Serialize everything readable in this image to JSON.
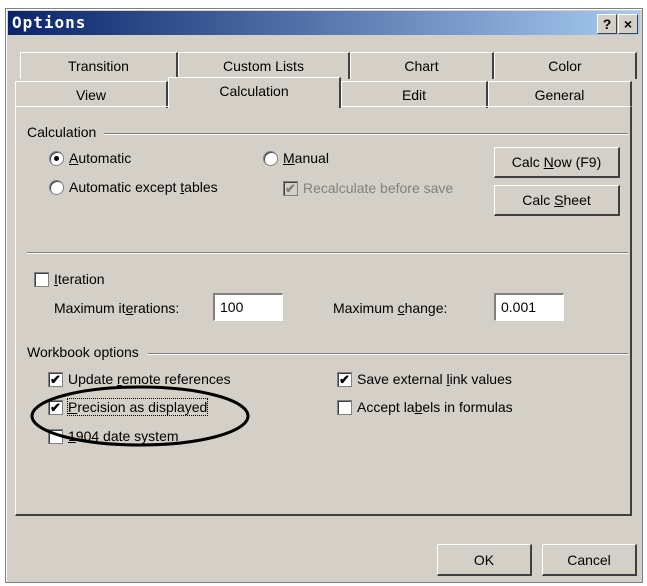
{
  "window": {
    "title": "Options",
    "help_btn": "?",
    "close_btn": "×"
  },
  "tabs_back": [
    "Transition",
    "Custom Lists",
    "Chart",
    "Color"
  ],
  "tabs_front": [
    "View",
    "Calculation",
    "Edit",
    "General"
  ],
  "calculation": {
    "group_label": "Calculation",
    "automatic": "Automatic",
    "automatic_except_tables": "Automatic except tables",
    "manual": "Manual",
    "recalc_before_save": "Recalculate before save",
    "calc_now": "Calc Now (F9)",
    "calc_sheet": "Calc Sheet"
  },
  "iteration": {
    "label": "Iteration",
    "max_iterations_label": "Maximum iterations:",
    "max_iterations_value": "100",
    "max_change_label": "Maximum change:",
    "max_change_value": "0.001"
  },
  "workbook": {
    "group_label": "Workbook options",
    "update_remote": "Update remote references",
    "precision": "Precision as displayed",
    "date_1904": "1904 date system",
    "save_external": "Save external link values",
    "accept_labels": "Accept labels in formulas"
  },
  "buttons": {
    "ok": "OK",
    "cancel": "Cancel"
  }
}
